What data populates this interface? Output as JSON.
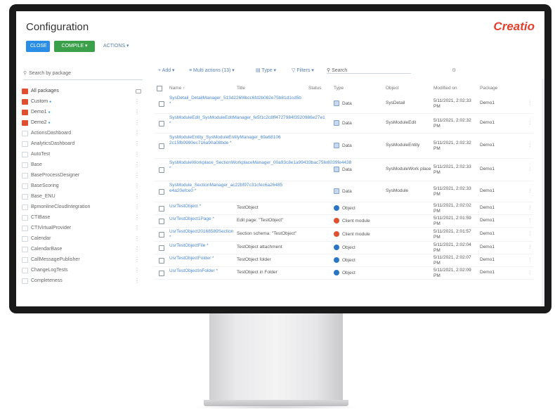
{
  "header": {
    "title": "Configuration",
    "logo": "Creatio",
    "close_label": "CLOSE",
    "compile_label": "COMPILE ▾",
    "actions_label": "ACTIONS ▾"
  },
  "left": {
    "search_placeholder": "Search by package",
    "packages": [
      {
        "label": "All packages",
        "kind": "folder",
        "modified": false,
        "ghost": false
      },
      {
        "label": "Custom",
        "kind": "pkg",
        "modified": true
      },
      {
        "label": "Demo1",
        "kind": "pkg",
        "modified": true
      },
      {
        "label": "Demo2",
        "kind": "pkg",
        "modified": true
      },
      {
        "label": "ActionsDashboard",
        "kind": "ghost",
        "modified": false
      },
      {
        "label": "AnalyticsDashboard",
        "kind": "ghost",
        "modified": false
      },
      {
        "label": "AutoTest",
        "kind": "ghost",
        "modified": false
      },
      {
        "label": "Base",
        "kind": "ghost",
        "modified": false
      },
      {
        "label": "BaseProcessDesigner",
        "kind": "ghost",
        "modified": false
      },
      {
        "label": "BaseScoring",
        "kind": "ghost",
        "modified": false
      },
      {
        "label": "Base_ENU",
        "kind": "ghost",
        "modified": false
      },
      {
        "label": "BpmonlineCloudIntegration",
        "kind": "ghost",
        "modified": false
      },
      {
        "label": "CTIBase",
        "kind": "ghost",
        "modified": false
      },
      {
        "label": "CTIVirtualProvider",
        "kind": "ghost",
        "modified": false
      },
      {
        "label": "Calendar",
        "kind": "ghost",
        "modified": false
      },
      {
        "label": "CalendarBase",
        "kind": "ghost",
        "modified": false
      },
      {
        "label": "CallMessagePublisher",
        "kind": "ghost",
        "modified": false
      },
      {
        "label": "ChangeLogTests",
        "kind": "ghost",
        "modified": false
      },
      {
        "label": "Completeness",
        "kind": "ghost",
        "modified": false
      }
    ]
  },
  "toolbar": {
    "add": "+ Add ▾",
    "multi": "≡ Multi actions (13) ▾",
    "type": "▤ Type ▾",
    "filters": "▽ Filters ▾",
    "search_placeholder": "Search"
  },
  "table": {
    "headers": {
      "name": "Name ↑",
      "title": "Title",
      "status": "Status",
      "type": "Type",
      "object": "Object",
      "modified": "Modified on",
      "package": "Package"
    },
    "rows": [
      {
        "name": "SysDetail_DetailManager_513d226f4bcc6fd2b082e75b81d1cd5b *",
        "title": "",
        "type": "Data",
        "icon": "data",
        "object": "SysDetail",
        "modified": "5/11/2021, 2:02:33 PM",
        "package": "Demo1",
        "h": 28
      },
      {
        "name": "SysModuleEdit_SysModuleEditManager_fe5f1c2c8ff4727984f3520986e27e1 *",
        "title": "",
        "type": "Data",
        "icon": "data",
        "object": "SysModuleEdit",
        "modified": "5/11/2021, 2:02:32 PM",
        "package": "Demo1",
        "h": 28
      },
      {
        "name": "SysModuleEntity_SysModuleEntityManager_69a68106 2c15fb0990ec716a90a08bde *",
        "title": "",
        "type": "Data",
        "icon": "data",
        "object": "SysModuleEntity",
        "modified": "5/11/2021, 2:02:32 PM",
        "package": "Demo1",
        "h": 36
      },
      {
        "name": "SysModuleWorkplace_SectionWorkplaceManager_00a93c8e1a99433bac75fe8039fe4438 *",
        "title": "",
        "type": "Data",
        "icon": "data",
        "object": "SysModuleWork place",
        "modified": "5/11/2021, 2:02:33 PM",
        "package": "Demo1",
        "h": 32
      },
      {
        "name": "SysModule_SectionManager_ac22bf97c31cfec6a26485 e4a20efce0 *",
        "title": "",
        "type": "Data",
        "icon": "data",
        "object": "SysModule",
        "modified": "5/11/2021, 2:02:33 PM",
        "package": "Demo1",
        "h": 30
      },
      {
        "name": "UsrTestObject *",
        "title": "TestObject",
        "type": "Object",
        "icon": "object",
        "object": "",
        "modified": "5/11/2021, 2:02:02 PM",
        "package": "Demo1",
        "h": 18
      },
      {
        "name": "UsrTestObject1Page *",
        "title": "Edit page: \"TestObject\"",
        "type": "Client module",
        "icon": "client",
        "object": "",
        "modified": "5/11/2021, 2:01:59 PM",
        "package": "Demo1",
        "h": 18
      },
      {
        "name": "UsrTestObject20168589Section *",
        "title": "Section schema: \"TestObject\"",
        "type": "Client module",
        "icon": "client",
        "object": "",
        "modified": "5/11/2021, 2:01:57 PM",
        "package": "Demo1",
        "h": 20
      },
      {
        "name": "UsrTestObjectFile *",
        "title": "TestObject attachment",
        "type": "Object",
        "icon": "object",
        "object": "",
        "modified": "5/11/2021, 2:02:04 PM",
        "package": "Demo1",
        "h": 18
      },
      {
        "name": "UsrTestObjectFolder *",
        "title": "TestObject folder",
        "type": "Object",
        "icon": "object",
        "object": "",
        "modified": "5/11/2021, 2:02:07 PM",
        "package": "Demo1",
        "h": 18
      },
      {
        "name": "UsrTestObjectInFolder *",
        "title": "TestObject in Folder",
        "type": "Object",
        "icon": "object",
        "object": "",
        "modified": "5/11/2021, 2:02:09 PM",
        "package": "Demo1",
        "h": 18
      }
    ]
  },
  "colors": {
    "accent": "#2a8ee6",
    "compile": "#3aa14a",
    "brand": "#e0402f",
    "link": "#4a88d6"
  }
}
